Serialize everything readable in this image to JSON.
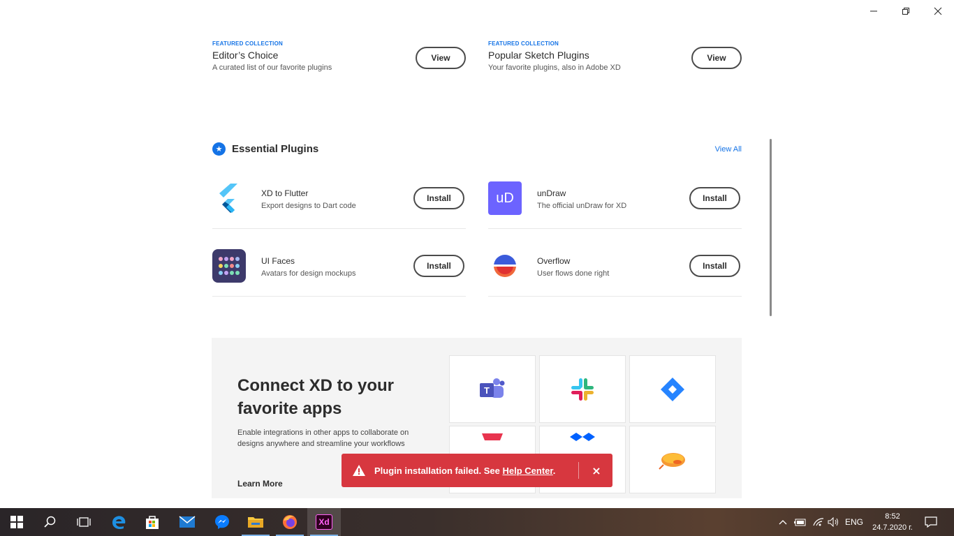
{
  "window": {
    "minimize_icon": "minimize-icon",
    "maximize_icon": "restore-icon",
    "close_icon": "close-icon"
  },
  "featured": [
    {
      "tag": "FEATURED COLLECTION",
      "title": "Editor’s Choice",
      "description": "A curated list of our favorite plugins",
      "button": "View"
    },
    {
      "tag": "FEATURED COLLECTION",
      "title": "Popular Sketch Plugins",
      "description": "Your favorite plugins, also in Adobe XD",
      "button": "View"
    }
  ],
  "essential": {
    "title": "Essential Plugins",
    "view_all": "View All",
    "plugins": [
      {
        "name": "XD to Flutter",
        "description": "Export designs to Dart code",
        "button": "Install",
        "icon": "flutter-icon"
      },
      {
        "name": "unDraw",
        "description": "The official unDraw for XD",
        "button": "Install",
        "icon": "undraw-icon",
        "icon_text": "uD"
      },
      {
        "name": "UI Faces",
        "description": "Avatars for design mockups",
        "button": "Install",
        "icon": "ui-faces-icon"
      },
      {
        "name": "Overflow",
        "description": "User flows done right",
        "button": "Install",
        "icon": "overflow-icon"
      }
    ]
  },
  "connect": {
    "title": "Connect XD to your favorite apps",
    "description": "Enable integrations in other apps to collaborate on designs anywhere and streamline your workflows",
    "learn_more": "Learn More",
    "apps": [
      "teams-icon",
      "slack-icon",
      "jira-icon",
      "app-icon",
      "dropbox-icon",
      "zeplin-icon"
    ]
  },
  "toast": {
    "message_prefix": "Plugin installation failed. See ",
    "link": "Help Center",
    "message_suffix": ".",
    "close": "×"
  },
  "taskbar": {
    "items": [
      "start-icon",
      "search-icon",
      "task-view-icon",
      "edge-icon",
      "store-icon",
      "mail-icon",
      "messenger-icon",
      "file-explorer-icon",
      "firefox-icon",
      "adobe-xd-icon"
    ],
    "xd_label": "Xd",
    "language": "ENG",
    "time": "8:52",
    "date": "24.7.2020 г."
  },
  "colors": {
    "accent": "#1473e6",
    "error": "#d7373f",
    "undraw": "#6c63ff",
    "ui_faces": "#3d3a6b"
  }
}
